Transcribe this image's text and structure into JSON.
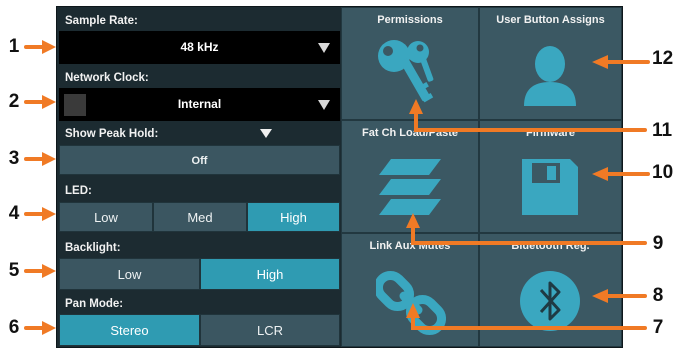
{
  "colors": {
    "accent": "#2f9bb2",
    "arrow": "#f07a25",
    "panel": "#1c2b31",
    "button": "#3b5661"
  },
  "left": {
    "sample_rate": {
      "label": "Sample Rate:",
      "value": "48 kHz"
    },
    "network_clock": {
      "label": "Network Clock:",
      "value": "Internal"
    },
    "show_peak_hold": {
      "label": "Show Peak Hold:",
      "value": "Off"
    },
    "led": {
      "label": "LED:",
      "options": [
        "Low",
        "Med",
        "High"
      ],
      "selected": "High"
    },
    "backlight": {
      "label": "Backlight:",
      "options": [
        "Low",
        "High"
      ],
      "selected": "High"
    },
    "pan_mode": {
      "label": "Pan Mode:",
      "options": [
        "Stereo",
        "LCR"
      ],
      "selected": "Stereo"
    }
  },
  "grid": [
    {
      "label": "Permissions",
      "icon": "keys-icon"
    },
    {
      "label": "User Button Assigns",
      "icon": "user-icon"
    },
    {
      "label": "Fat Ch Load/Paste",
      "icon": "layers-icon"
    },
    {
      "label": "Firmware",
      "icon": "floppy-disk-icon"
    },
    {
      "label": "Link Aux Mutes",
      "icon": "link-icon"
    },
    {
      "label": "Bluetooth Reg.",
      "icon": "bluetooth-icon"
    }
  ],
  "callouts": [
    "1",
    "2",
    "3",
    "4",
    "5",
    "6",
    "7",
    "8",
    "9",
    "10",
    "11",
    "12"
  ]
}
